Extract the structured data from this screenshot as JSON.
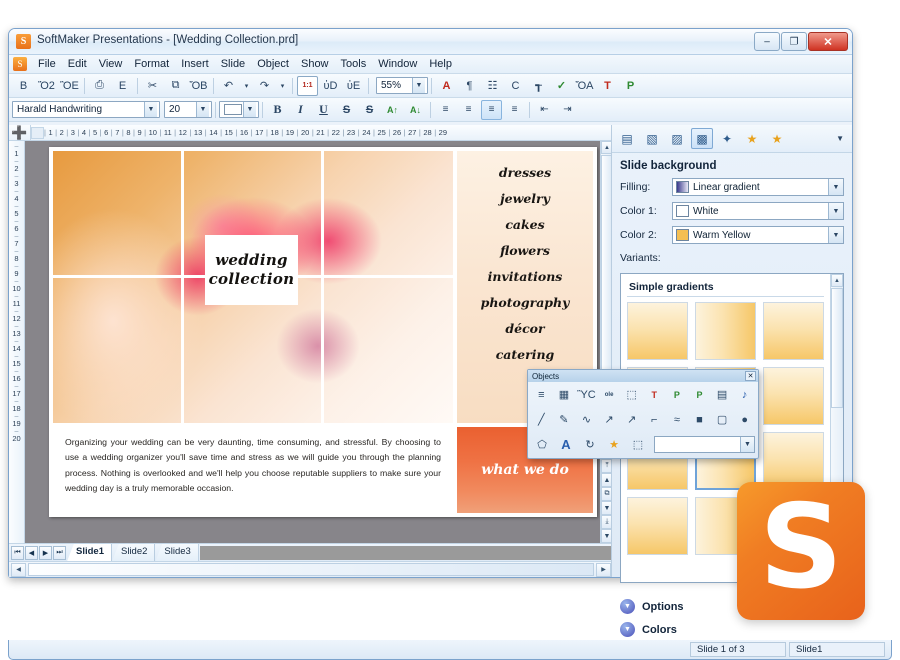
{
  "window": {
    "title": "SoftMaker Presentations - [Wedding Collection.prd]",
    "app_icon": "S",
    "minimize_label": "–",
    "maximize_label": "❐",
    "close_label": "✕"
  },
  "menu": {
    "logo_icon": "softmaker-logo-icon",
    "items": [
      "File",
      "Edit",
      "View",
      "Format",
      "Insert",
      "Slide",
      "Object",
      "Show",
      "Tools",
      "Window",
      "Help"
    ]
  },
  "standard_toolbar": {
    "zoom_value": "55%",
    "buttons": [
      {
        "name": "new-document-button",
        "glyph": "὜B"
      },
      {
        "name": "open-button",
        "glyph": "Ὄ2"
      },
      {
        "name": "save-button",
        "glyph": "ὋE"
      },
      {
        "name": "print-button",
        "glyph": "⎙"
      },
      {
        "name": "export-pdf-button",
        "glyph": "὜E"
      },
      {
        "name": "cut-button",
        "glyph": "✂"
      },
      {
        "name": "copy-button",
        "glyph": "⧉"
      },
      {
        "name": "paste-button",
        "glyph": "ὌB"
      },
      {
        "name": "undo-button",
        "glyph": "↶"
      },
      {
        "name": "undo-dropdown",
        "glyph": "▾"
      },
      {
        "name": "redo-button",
        "glyph": "↷"
      },
      {
        "name": "redo-dropdown",
        "glyph": "▾"
      },
      {
        "name": "zoom-actual-size-button",
        "glyph": "1:1"
      },
      {
        "name": "zoom-selection-button",
        "glyph": "ὐD"
      },
      {
        "name": "zoom-button",
        "glyph": "ὐE"
      },
      {
        "name": "character-format-button",
        "glyph": "A"
      },
      {
        "name": "paragraph-format-button",
        "glyph": "¶"
      },
      {
        "name": "bullet-list-button",
        "glyph": "☷"
      },
      {
        "name": "format-painter-button",
        "glyph": "὘C"
      },
      {
        "name": "table-button",
        "glyph": "┱"
      },
      {
        "name": "spellcheck-button",
        "glyph": "✓"
      },
      {
        "name": "chart-button",
        "glyph": "ὌA"
      },
      {
        "name": "textmaker-button",
        "glyph": "T"
      },
      {
        "name": "planmaker-button",
        "glyph": "P"
      }
    ]
  },
  "format_toolbar": {
    "font_name": "Harald Handwriting",
    "font_size": "20",
    "color_swatch": "#ffffff",
    "buttons": [
      {
        "name": "bold-button",
        "glyph": "B"
      },
      {
        "name": "italic-button",
        "glyph": "I"
      },
      {
        "name": "underline-button",
        "glyph": "U"
      },
      {
        "name": "strikethrough-button",
        "glyph": "S"
      },
      {
        "name": "clear-formatting-button",
        "glyph": "S"
      },
      {
        "name": "increase-font-size-button",
        "glyph": "A↑"
      },
      {
        "name": "decrease-font-size-button",
        "glyph": "A↓"
      },
      {
        "name": "align-left-button",
        "glyph": "≡"
      },
      {
        "name": "align-right-button",
        "glyph": "≡"
      },
      {
        "name": "align-center-button",
        "glyph": "≡"
      },
      {
        "name": "align-justify-button",
        "glyph": "≡"
      },
      {
        "name": "decrease-indent-button",
        "glyph": "⇤"
      },
      {
        "name": "increase-indent-button",
        "glyph": "⇥"
      }
    ]
  },
  "rulers": {
    "horizontal_ticks": [
      "1",
      "2",
      "3",
      "4",
      "5",
      "6",
      "7",
      "8",
      "9",
      "10",
      "11",
      "12",
      "13",
      "14",
      "15",
      "16",
      "17",
      "18",
      "19",
      "20",
      "21",
      "22",
      "23",
      "24",
      "25",
      "26",
      "27",
      "28",
      "29"
    ],
    "vertical_ticks": [
      "1",
      "2",
      "3",
      "4",
      "5",
      "6",
      "7",
      "8",
      "9",
      "10",
      "11",
      "12",
      "13",
      "14",
      "15",
      "16",
      "17",
      "18",
      "19",
      "20"
    ],
    "corner_icon": "tab-stop-icon"
  },
  "slide": {
    "card_line1": "wedding",
    "card_line2": "collection",
    "services": [
      "dresses",
      "jewelry",
      "cakes",
      "flowers",
      "invitations",
      "photography",
      "décor",
      "catering"
    ],
    "paragraph": "Organizing your wedding can be very daunting, time consuming, and stressful. By choosing to use a wedding organizer you'll save time and stress as we will guide you through the planning process. Nothing is overlooked and we'll help you choose reputable suppliers to make sure your wedding day is a truly memorable occasion.",
    "what_we_do": "what we do"
  },
  "slide_tabs": {
    "nav_buttons": [
      {
        "name": "first-slide-button",
        "glyph": "⏮"
      },
      {
        "name": "previous-slide-button",
        "glyph": "◀"
      },
      {
        "name": "next-slide-button",
        "glyph": "▶"
      },
      {
        "name": "last-slide-button",
        "glyph": "⏭"
      }
    ],
    "tabs": [
      {
        "label": "Slide1",
        "active": true
      },
      {
        "label": "Slide2",
        "active": false
      },
      {
        "label": "Slide3",
        "active": false
      }
    ]
  },
  "canvas_scroll": {
    "buttons": [
      {
        "name": "scroll-up-button",
        "glyph": "▲"
      },
      {
        "name": "go-to-top-button",
        "glyph": "⤒"
      },
      {
        "name": "previous-object-button",
        "glyph": "▲"
      },
      {
        "name": "select-object-button",
        "glyph": "⧉"
      },
      {
        "name": "next-object-button",
        "glyph": "▼"
      },
      {
        "name": "go-to-bottom-button",
        "glyph": "⤓"
      },
      {
        "name": "scroll-down-button",
        "glyph": "▼"
      }
    ]
  },
  "sidepanel": {
    "toolbar_icons": [
      {
        "name": "slide-layout-icon",
        "glyph": "▤",
        "selected": false
      },
      {
        "name": "master-slide-icon",
        "glyph": "▧",
        "selected": false
      },
      {
        "name": "color-scheme-icon",
        "glyph": "▨",
        "selected": false
      },
      {
        "name": "slide-background-icon",
        "glyph": "▩",
        "selected": true
      },
      {
        "name": "transition-icon",
        "glyph": "✦",
        "selected": false
      },
      {
        "name": "animation-icon",
        "glyph": "★",
        "selected": false
      },
      {
        "name": "favorites-icon",
        "glyph": "★",
        "selected": false
      }
    ],
    "dropdown_icon": "chevron-down-icon",
    "title": "Slide background",
    "fields": [
      {
        "label": "Filling:",
        "value": "Linear gradient",
        "preview": "#8d8ecf",
        "name": "filling-dropdown"
      },
      {
        "label": "Color 1:",
        "value": "White",
        "preview": "#ffffff",
        "name": "color1-dropdown"
      },
      {
        "label": "Color 2:",
        "value": "Warm Yellow",
        "preview": "#f5bf52",
        "name": "color2-dropdown"
      }
    ],
    "variants_label": "Variants:",
    "variants_group": "Simple gradients",
    "variant_count": 12,
    "selected_variant": 7,
    "sections": [
      {
        "label": "Options",
        "name": "options-section",
        "icon": "chevron-down-circle-icon"
      },
      {
        "label": "Colors",
        "name": "colors-section",
        "icon": "chevron-down-circle-icon"
      }
    ]
  },
  "objects_palette": {
    "title": "Objects",
    "close_label": "✕",
    "row1": [
      {
        "name": "text-frame-tool",
        "glyph": "≡"
      },
      {
        "name": "table-frame-tool",
        "glyph": "▦"
      },
      {
        "name": "picture-frame-tool",
        "glyph": "ὛC"
      },
      {
        "name": "ole-object-tool",
        "glyph": "ole"
      },
      {
        "name": "group-tool",
        "glyph": "⬚"
      },
      {
        "name": "textmaker-object-tool",
        "glyph": "T"
      },
      {
        "name": "planmaker-object-tool",
        "glyph": "P"
      },
      {
        "name": "presentations-object-tool",
        "glyph": "P"
      },
      {
        "name": "media-object-tool",
        "glyph": "▤"
      },
      {
        "name": "sound-object-tool",
        "glyph": "♪"
      }
    ],
    "row2": [
      {
        "name": "line-tool",
        "glyph": "╱"
      },
      {
        "name": "freehand-tool",
        "glyph": "✎"
      },
      {
        "name": "curve-tool",
        "glyph": "∿"
      },
      {
        "name": "arrow-tool",
        "glyph": "↗"
      },
      {
        "name": "connector-straight-tool",
        "glyph": "↗"
      },
      {
        "name": "connector-angled-tool",
        "glyph": "⌐"
      },
      {
        "name": "connector-curved-tool",
        "glyph": "≈"
      },
      {
        "name": "rectangle-tool",
        "glyph": "■"
      },
      {
        "name": "rounded-rectangle-tool",
        "glyph": "▢"
      },
      {
        "name": "ellipse-tool",
        "glyph": "●"
      }
    ],
    "row3": [
      {
        "name": "autoshape-tool",
        "glyph": "⬠"
      },
      {
        "name": "arttext-tool",
        "glyph": "A"
      },
      {
        "name": "rotate-tool",
        "glyph": "↻"
      },
      {
        "name": "star-tool",
        "glyph": "★"
      },
      {
        "name": "select-objects-tool",
        "glyph": "⬚"
      }
    ],
    "combo_value": ""
  },
  "statusbar": {
    "slide_position": "Slide 1 of 3",
    "slide_name": "Slide1"
  },
  "logo": {
    "letter": "S",
    "color": "#ee7722"
  }
}
